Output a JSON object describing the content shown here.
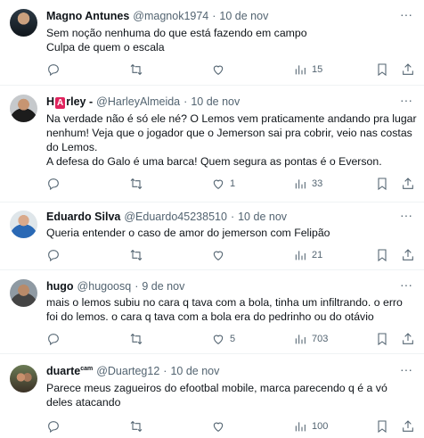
{
  "tweets": [
    {
      "name": "Magno Antunes",
      "handle": "@magnok1974",
      "sep": "·",
      "date": "10 de nov",
      "lines": [
        "Sem noção nenhuma do que está fazendo em campo",
        "Culpa de quem o escala"
      ],
      "replies": "",
      "retweets": "",
      "likes": "",
      "views": "15"
    },
    {
      "name_prefix": "H",
      "name_badge": "A",
      "name_suffix": "rley -",
      "handle": "@HarleyAlmeida",
      "sep": "·",
      "date": "10 de nov",
      "lines": [
        "Na verdade não é só ele né? O Lemos vem praticamente andando pra lugar",
        "nenhum! Veja que o jogador que o Jemerson sai pra cobrir, veio nas costas",
        "do Lemos.",
        "A defesa do Galo é uma barca! Quem segura as pontas é o Everson."
      ],
      "replies": "",
      "retweets": "",
      "likes": "1",
      "views": "33"
    },
    {
      "name": "Eduardo Silva",
      "handle": "@Eduardo45238510",
      "sep": "·",
      "date": "10 de nov",
      "lines": [
        "Queria entender o caso de amor do jemerson com Felipão"
      ],
      "replies": "",
      "retweets": "",
      "likes": "",
      "views": "21"
    },
    {
      "name": "hugo",
      "handle": "@hugoosq",
      "sep": "·",
      "date": "9 de nov",
      "lines": [
        "mais o lemos subiu no cara q tava com a bola, tinha um infiltrando. o erro",
        "foi do lemos. o cara q tava com a bola era do pedrinho ou do otávio"
      ],
      "replies": "",
      "retweets": "",
      "likes": "5",
      "views": "703"
    },
    {
      "name": "duarte",
      "name_sup": "cam",
      "handle": "@Duarteg12",
      "sep": "·",
      "date": "10 de nov",
      "lines": [
        "Parece meus zagueiros do efootbal mobile, marca parecendo q é a vó",
        "deles atacando"
      ],
      "replies": "",
      "retweets": "",
      "likes": "",
      "views": "100"
    }
  ],
  "icons": {
    "more": "more-options-icon",
    "reply": "reply-icon",
    "retweet": "retweet-icon",
    "like": "heart-icon",
    "views": "views-chart-icon",
    "bookmark": "bookmark-icon",
    "share": "share-icon"
  },
  "colors": {
    "text": "#0f1419",
    "secondary": "#536471",
    "divider": "#eff3f4",
    "badge": "#e0245e"
  }
}
